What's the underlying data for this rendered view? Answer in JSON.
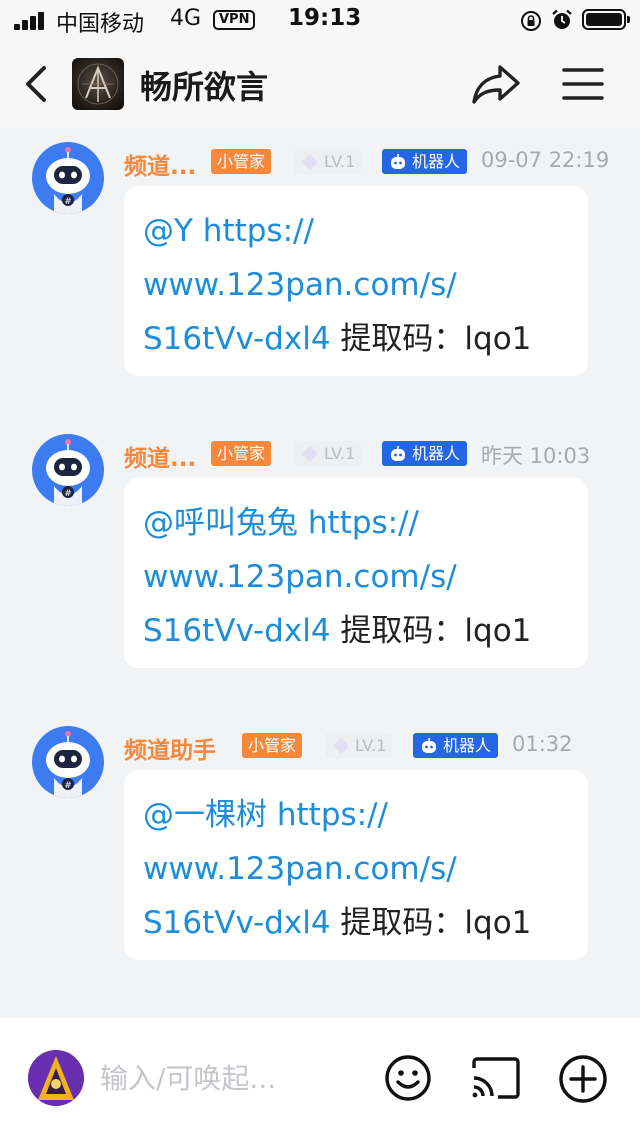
{
  "status_bar": {
    "carrier": "中国移动",
    "network": "4G",
    "vpn": "VPN",
    "time": "19:13"
  },
  "header": {
    "title": "畅所欲言"
  },
  "messages": [
    {
      "sender": "频道...",
      "admin_badge": "小管家",
      "level_badge": "LV.1",
      "bot_badge": "机器人",
      "time": "09-07 22:19",
      "mention": "@Y",
      "link_line1": "https://",
      "link_line2": "www.123pan.com/s/",
      "link_line3": "S16tVv-dxl4",
      "code_text": "提取码：lqo1"
    },
    {
      "sender": "频道...",
      "admin_badge": "小管家",
      "level_badge": "LV.1",
      "bot_badge": "机器人",
      "time": "昨天 10:03",
      "mention": "@呼叫兔兔",
      "link_line1": "https://",
      "link_line2": "www.123pan.com/s/",
      "link_line3": "S16tVv-dxl4",
      "code_text": "提取码：lqo1"
    },
    {
      "sender": "频道助手",
      "admin_badge": "小管家",
      "level_badge": "LV.1",
      "bot_badge": "机器人",
      "time": "01:32",
      "mention": "@一棵树",
      "link_line1": "https://",
      "link_line2": "www.123pan.com/s/",
      "link_line3": "S16tVv-dxl4",
      "code_text": "提取码：lqo1"
    }
  ],
  "input_bar": {
    "placeholder": "输入/可唤起..."
  },
  "icons": {
    "back": "chevron-left-icon",
    "share": "share-arrow-icon",
    "menu": "hamburger-menu-icon",
    "emoji": "emoji-smile-icon",
    "cast": "screen-cast-icon",
    "plus": "plus-circle-icon"
  },
  "colors": {
    "sender": "#f5883c",
    "admin_badge": "#f5883c",
    "bot_badge": "#2466e6",
    "link": "#1b8ddb",
    "background": "#f2f3f5"
  }
}
